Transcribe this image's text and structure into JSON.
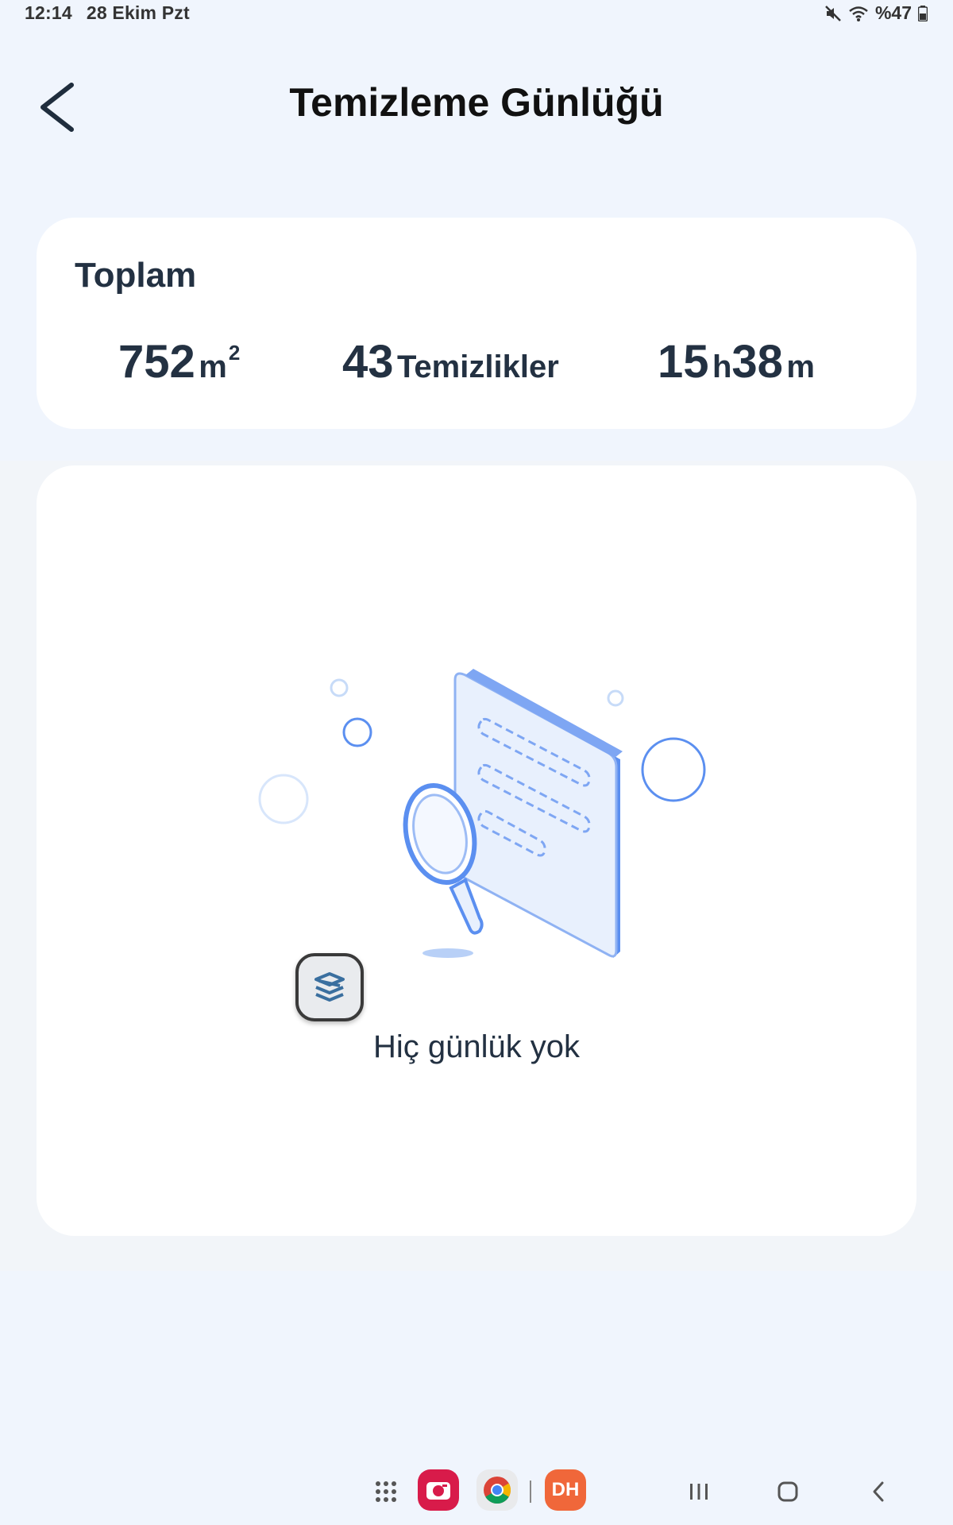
{
  "status_bar": {
    "time": "12:14",
    "date": "28 Ekim Pzt",
    "battery": "%47",
    "icons": [
      "mute-icon",
      "wifi-icon",
      "battery-icon"
    ]
  },
  "header": {
    "title": "Temizleme Günlüğü",
    "back_icon": "back-arrow-icon"
  },
  "summary": {
    "title": "Toplam",
    "area_value": "752",
    "area_unit": "m",
    "area_unit_sup": "2",
    "count_value": "43",
    "count_unit": "Temizlikler",
    "time_hours": "15",
    "time_hours_unit": "h",
    "time_minutes": "38",
    "time_minutes_unit": "m"
  },
  "empty_state": {
    "message": "Hiç günlük yok",
    "illustration": "document-magnifier-illustration"
  },
  "floating_badge": {
    "icon": "app-logo-icon"
  },
  "nav_bar": {
    "apps": [
      {
        "icon": "app-grid-icon"
      },
      {
        "icon": "camera-app-icon",
        "color": "#d81b4a"
      },
      {
        "icon": "chrome-app-icon"
      },
      {
        "icon": "dh-app-icon",
        "label": "DH",
        "color": "#f0673a"
      }
    ],
    "buttons": [
      "recents-icon",
      "home-icon",
      "nav-back-icon"
    ]
  },
  "colors": {
    "background": "#f0f5fd",
    "card": "#ffffff",
    "text_primary": "#233142",
    "illustration_blue": "#5b8ff0"
  }
}
